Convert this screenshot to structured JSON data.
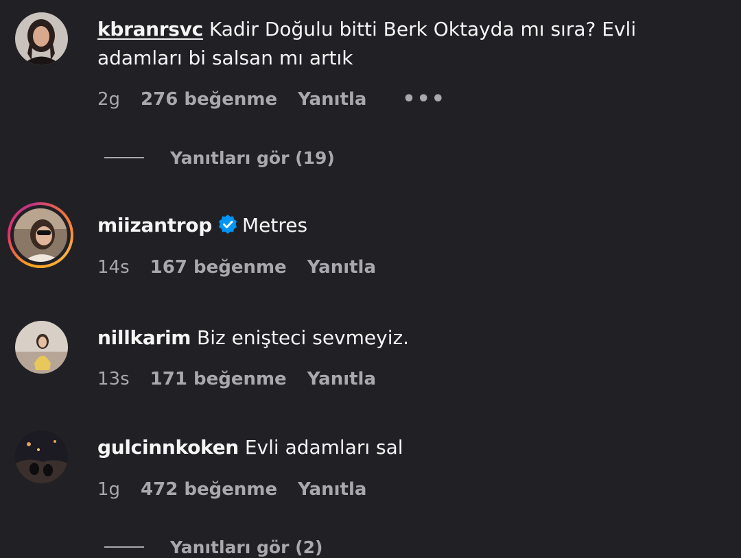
{
  "comments": [
    {
      "username": "kbranrsvc",
      "text": "Kadir Doğulu bitti Berk Oktayda mı sıra? Evli",
      "text_line2": "adamları bi salsan mı artık",
      "time": "2g",
      "likes": "276 beğenme",
      "reply": "Yanıtla",
      "more": "•••",
      "view_replies": "Yanıtları gör (19)"
    },
    {
      "username": "miizantrop",
      "verified": true,
      "text": "Metres",
      "time": "14s",
      "likes": "167 beğenme",
      "reply": "Yanıtla"
    },
    {
      "username": "nillkarim",
      "text": "Biz enişteci sevmeyiz.",
      "time": "13s",
      "likes": "171 beğenme",
      "reply": "Yanıtla"
    },
    {
      "username": "gulcinnkoken",
      "text": "Evli adamları sal",
      "time": "1g",
      "likes": "472 beğenme",
      "reply": "Yanıtla",
      "view_replies": "Yanıtları gör (2)"
    }
  ],
  "colors": {
    "background": "#212125",
    "text": "#f5f5f5",
    "meta": "#a8a8ae",
    "verified": "#0095f6"
  },
  "icons": {
    "verified": "verified-badge-icon",
    "more": "more-options-icon"
  }
}
